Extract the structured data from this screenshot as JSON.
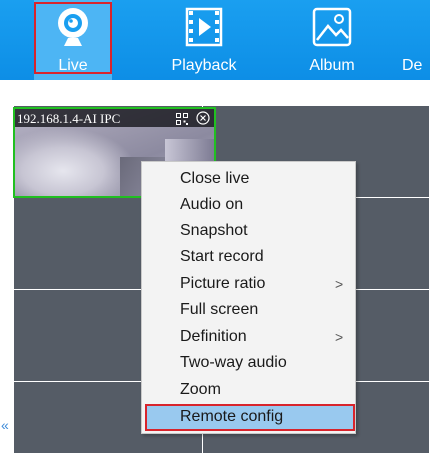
{
  "toolbar": {
    "live": {
      "label": "Live",
      "icon": "webcam-icon"
    },
    "playback": {
      "label": "Playback",
      "icon": "video-clip-icon"
    },
    "album": {
      "label": "Album",
      "icon": "image-icon"
    },
    "device": {
      "label": "De"
    },
    "accent_color": "#1a9ff0",
    "highlight_color": "#d8242c"
  },
  "video_tile": {
    "title": "192.168.1.4-AI IPC",
    "border_color": "#21c021",
    "qr_icon": "qr-code-icon",
    "close_icon": "close-circle-icon"
  },
  "context_menu": {
    "items": [
      {
        "label": "Close live"
      },
      {
        "label": "Audio on"
      },
      {
        "label": "Snapshot"
      },
      {
        "label": "Start record"
      },
      {
        "label": "Picture ratio",
        "submenu": ">"
      },
      {
        "label": "Full screen"
      },
      {
        "label": "Definition",
        "submenu": ">"
      },
      {
        "label": "Two-way audio"
      },
      {
        "label": "Zoom"
      },
      {
        "label": "Remote config",
        "active": true
      }
    ],
    "active_color": "#99c9ef"
  },
  "sidebar_toggle": {
    "label": "«"
  }
}
